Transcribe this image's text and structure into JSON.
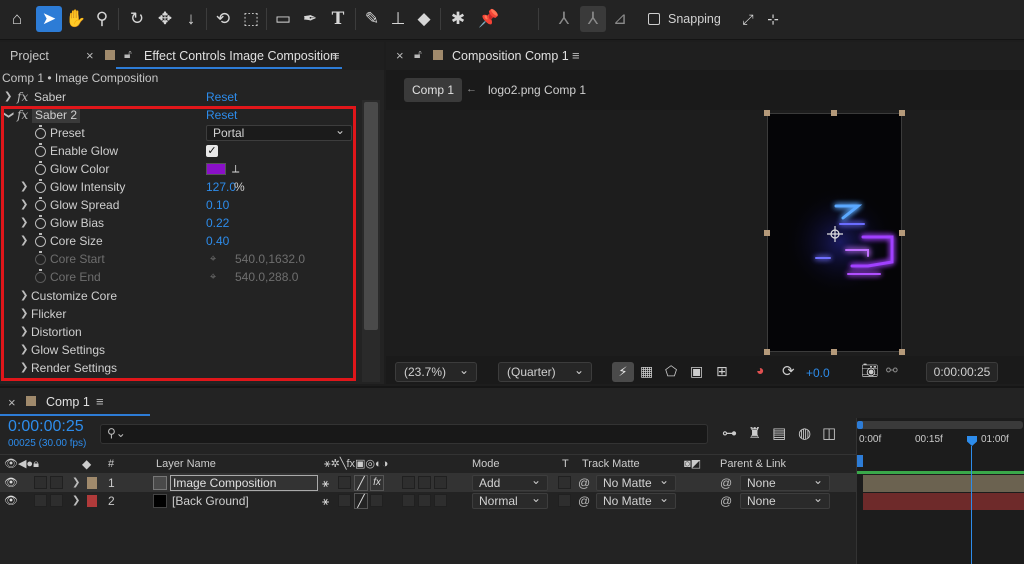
{
  "toolbar": {
    "snapping_label": "Snapping",
    "icons": [
      "home-icon",
      "selection-icon",
      "hand-icon",
      "zoom-icon",
      "orbit-icon",
      "pan-behind-icon",
      "dolly-icon",
      "rotate-icon",
      "anchor-icon",
      "rectangle-icon",
      "pen-icon",
      "type-icon",
      "brush-icon",
      "clone-stamp-icon",
      "eraser-icon",
      "roto-brush-icon",
      "puppet-pin-icon"
    ]
  },
  "left_panel": {
    "tab_project": "Project",
    "tab_effect_controls": "Effect Controls Image Composition",
    "breadcrumb": "Comp 1 • Image Composition",
    "effects": [
      {
        "name": "Saber",
        "reset": "Reset"
      },
      {
        "name": "Saber 2",
        "reset": "Reset"
      }
    ],
    "props": {
      "preset_label": "Preset",
      "preset_value": "Portal",
      "enable_glow_label": "Enable Glow",
      "glow_color_label": "Glow Color",
      "glow_color": "#8a10c8",
      "glow_intensity_label": "Glow Intensity",
      "glow_intensity_value": "127.0",
      "glow_intensity_unit": "%",
      "glow_spread_label": "Glow Spread",
      "glow_spread_value": "0.10",
      "glow_bias_label": "Glow Bias",
      "glow_bias_value": "0.22",
      "core_size_label": "Core Size",
      "core_size_value": "0.40",
      "core_start_label": "Core Start",
      "core_start_value": "540.0,1632.0",
      "core_end_label": "Core End",
      "core_end_value": "540.0,288.0"
    },
    "groups": [
      "Customize Core",
      "Flicker",
      "Distortion",
      "Glow Settings",
      "Render Settings"
    ]
  },
  "comp_panel": {
    "tab_label": "Composition Comp 1",
    "crumb_active": "Comp 1",
    "crumb_other": "logo2.png Comp 1",
    "zoom": "(23.7%)",
    "resolution": "(Quarter)",
    "exposure": "+0.0",
    "timecode": "0:00:00:25"
  },
  "timeline": {
    "tab_label": "Comp 1",
    "timecode": "0:00:00:25",
    "frames_fps": "00025 (30.00 fps)",
    "ruler": [
      "0:00f",
      "00:15f",
      "01:00f"
    ],
    "headers": {
      "num": "#",
      "layer_name": "Layer Name",
      "mode": "Mode",
      "t": "T",
      "track_matte": "Track Matte",
      "parent": "Parent & Link"
    },
    "layers": [
      {
        "num": "1",
        "name": "Image Composition",
        "mode": "Add",
        "matte": "No Matte",
        "parent": "None",
        "label_color": "#a08a6c"
      },
      {
        "num": "2",
        "name": "[Back Ground]",
        "mode": "Normal",
        "matte": "No Matte",
        "parent": "None",
        "label_color": "#b03a3a"
      }
    ]
  }
}
